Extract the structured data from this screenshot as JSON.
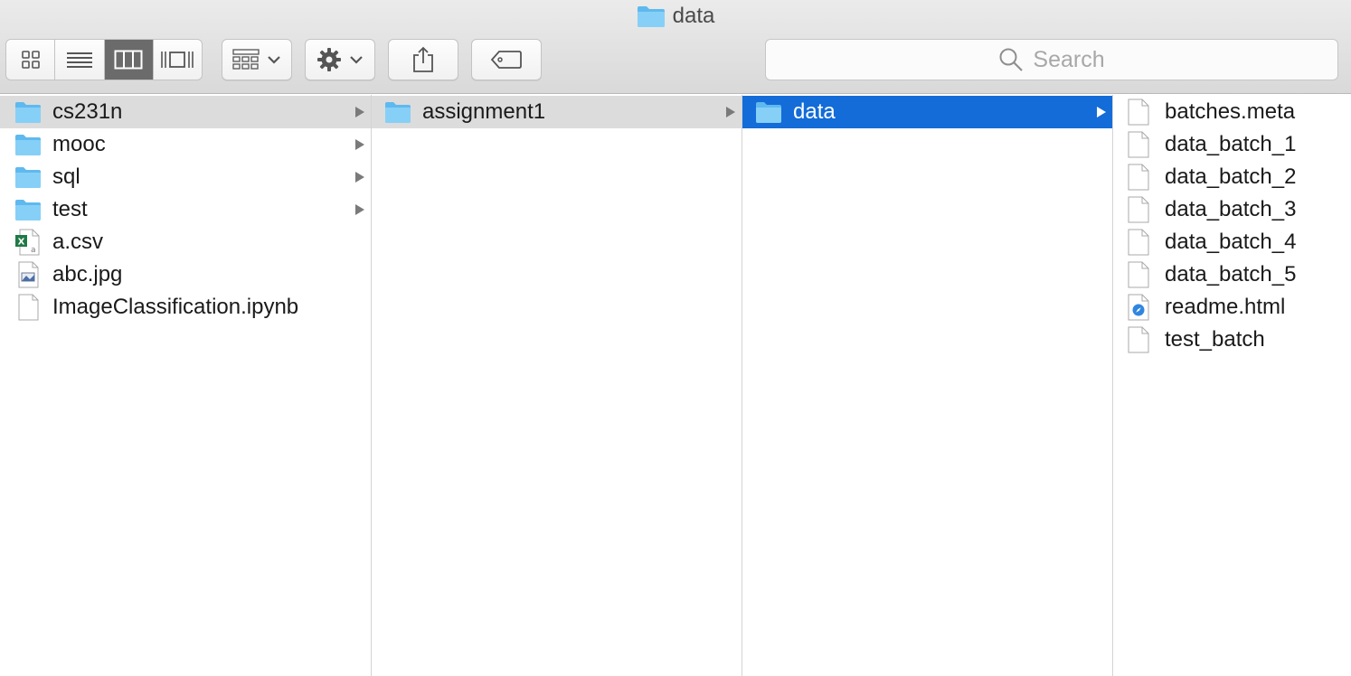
{
  "window": {
    "title": "data"
  },
  "toolbar": {
    "view_modes": [
      "icon-view",
      "list-view",
      "column-view",
      "cover-flow-view"
    ],
    "active_view": "column-view",
    "arrange_icon": "arrange-grid-icon",
    "action_icon": "gear-icon",
    "share_icon": "share-icon",
    "tag_icon": "tag-icon"
  },
  "search": {
    "placeholder": "Search"
  },
  "columns": [
    {
      "items": [
        {
          "label": "cs231n",
          "type": "folder",
          "has_children": true,
          "selected": "parent"
        },
        {
          "label": "mooc",
          "type": "folder",
          "has_children": true
        },
        {
          "label": "sql",
          "type": "folder",
          "has_children": true
        },
        {
          "label": "test",
          "type": "folder",
          "has_children": true
        },
        {
          "label": "a.csv",
          "type": "excel-file"
        },
        {
          "label": "abc.jpg",
          "type": "image-file"
        },
        {
          "label": "ImageClassification.ipynb",
          "type": "file"
        }
      ]
    },
    {
      "items": [
        {
          "label": "assignment1",
          "type": "folder",
          "has_children": true,
          "selected": "parent"
        }
      ]
    },
    {
      "items": [
        {
          "label": "data",
          "type": "folder",
          "has_children": true,
          "selected": "active"
        }
      ]
    },
    {
      "items": [
        {
          "label": "batches.meta",
          "type": "file"
        },
        {
          "label": "data_batch_1",
          "type": "file"
        },
        {
          "label": "data_batch_2",
          "type": "file"
        },
        {
          "label": "data_batch_3",
          "type": "file"
        },
        {
          "label": "data_batch_4",
          "type": "file"
        },
        {
          "label": "data_batch_5",
          "type": "file"
        },
        {
          "label": "readme.html",
          "type": "html-file"
        },
        {
          "label": "test_batch",
          "type": "file"
        }
      ]
    }
  ],
  "colors": {
    "folder_blue": "#6ec4f3",
    "selection_blue": "#136cd8",
    "selection_grey": "#dcdcdc"
  }
}
